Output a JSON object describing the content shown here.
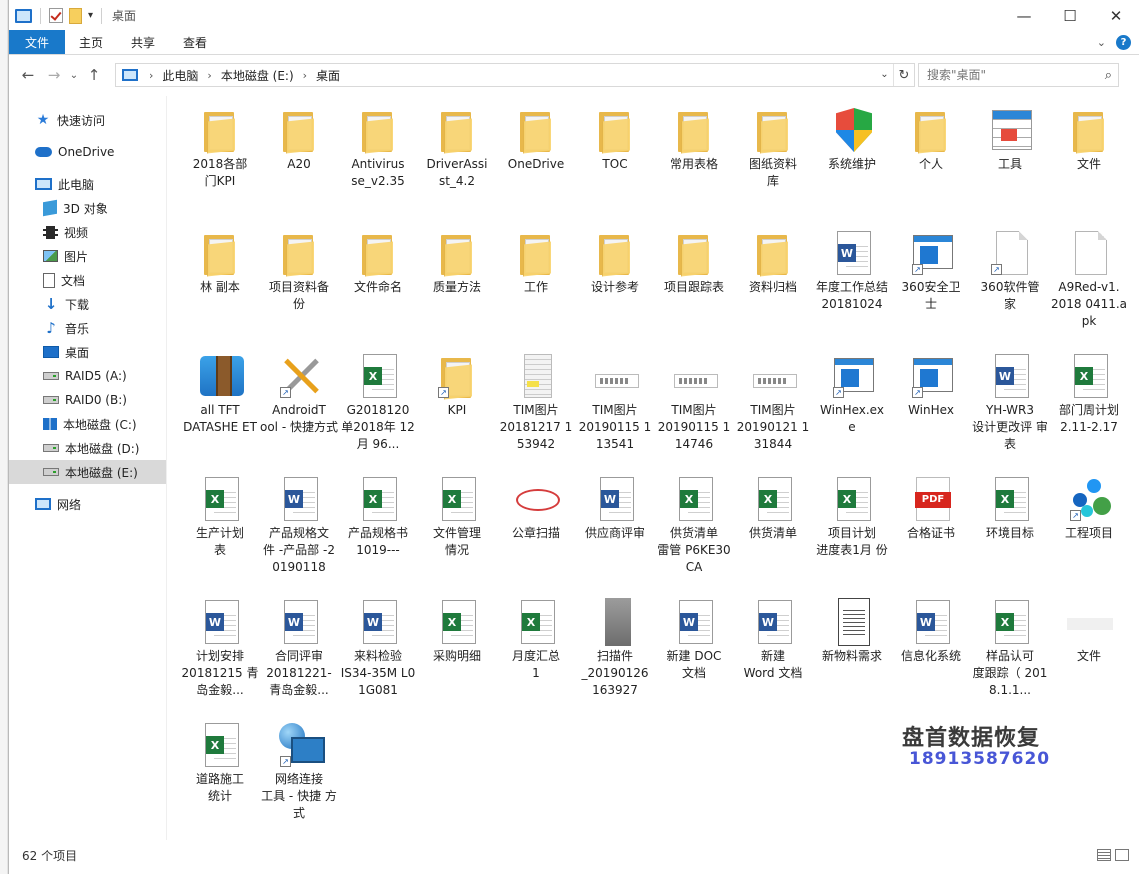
{
  "window": {
    "title": "桌面",
    "minimize_glyph": "—",
    "maximize_glyph": "☐",
    "close_glyph": "✕",
    "qa_dropdown_glyph": "▾"
  },
  "ribbon": {
    "tabs": [
      "文件",
      "主页",
      "共享",
      "查看"
    ],
    "expand_glyph": "⌄",
    "help_glyph": "?"
  },
  "nav_buttons": {
    "back": "←",
    "forward": "→",
    "recent": "⌄",
    "up": "↑"
  },
  "address": {
    "crumbs": [
      "此电脑",
      "本地磁盘 (E:)",
      "桌面"
    ],
    "sep": "›",
    "dropdown": "⌄",
    "refresh": "↻"
  },
  "search": {
    "placeholder": "搜索\"桌面\"",
    "icon": "⌕"
  },
  "navpane": {
    "items": [
      {
        "label": "快速访问",
        "icon": "star-icon"
      },
      {
        "label": "OneDrive",
        "icon": "cloud-icon"
      },
      {
        "label": "此电脑",
        "icon": "computer-icon"
      },
      {
        "label": "3D 对象",
        "icon": "cube-icon"
      },
      {
        "label": "视频",
        "icon": "video-icon"
      },
      {
        "label": "图片",
        "icon": "picture-icon"
      },
      {
        "label": "文档",
        "icon": "document-icon"
      },
      {
        "label": "下载",
        "icon": "download-icon"
      },
      {
        "label": "音乐",
        "icon": "music-icon"
      },
      {
        "label": "桌面",
        "icon": "desktop-icon"
      },
      {
        "label": "RAID5 (A:)",
        "icon": "drive-icon"
      },
      {
        "label": "RAID0 (B:)",
        "icon": "drive-icon"
      },
      {
        "label": "本地磁盘 (C:)",
        "icon": "windows-drive-icon"
      },
      {
        "label": "本地磁盘 (D:)",
        "icon": "drive-icon"
      },
      {
        "label": "本地磁盘 (E:)",
        "icon": "drive-icon"
      },
      {
        "label": "网络",
        "icon": "network-icon"
      }
    ]
  },
  "files": [
    {
      "a": "2018各部",
      "b": "门KPI",
      "icon": "folder"
    },
    {
      "a": "A20",
      "b": "",
      "icon": "folder"
    },
    {
      "a": "Antivirus",
      "b": "se_v2.35",
      "icon": "folder"
    },
    {
      "a": "DriverAssi",
      "b": "st_4.2",
      "icon": "folder"
    },
    {
      "a": "OneDrive",
      "b": "",
      "icon": "folder"
    },
    {
      "a": "TOC",
      "b": "",
      "icon": "folder"
    },
    {
      "a": "常用表格",
      "b": "",
      "icon": "folder"
    },
    {
      "a": "图纸资料",
      "b": "库",
      "icon": "folder"
    },
    {
      "a": "系统维护",
      "b": "",
      "icon": "shield"
    },
    {
      "a": "个人",
      "b": "",
      "icon": "folder"
    },
    {
      "a": "工具",
      "b": "",
      "icon": "calendar"
    },
    {
      "a": "文件",
      "b": "",
      "icon": "folder"
    },
    {
      "a": "林 副本",
      "b": "",
      "icon": "folder"
    },
    {
      "a": "项目资料备",
      "b": "份",
      "icon": "folder"
    },
    {
      "a": "文件命名",
      "b": "",
      "icon": "folder"
    },
    {
      "a": "质量方法",
      "b": "",
      "icon": "folder"
    },
    {
      "a": "工作",
      "b": "",
      "icon": "folder"
    },
    {
      "a": "设计参考",
      "b": "",
      "icon": "folder"
    },
    {
      "a": "项目跟踪表",
      "b": "",
      "icon": "folder"
    },
    {
      "a": "资料归档",
      "b": "",
      "icon": "folder"
    },
    {
      "a": "年度工作总结",
      "b": "20181024",
      "icon": "word"
    },
    {
      "a": "360安全卫",
      "b": "士",
      "icon": "winapp",
      "sc": true
    },
    {
      "a": "360软件管",
      "b": "家",
      "icon": "plain",
      "sc": true
    },
    {
      "a": "A9Red-v1.",
      "b": "2018 0411.apk",
      "icon": "plain"
    },
    {
      "a": "all TFT",
      "b": "DATASHE ET",
      "icon": "archive"
    },
    {
      "a": "AndroidT",
      "b": "ool - 快捷方式",
      "icon": "tools",
      "sc": true
    },
    {
      "a": "G2018120",
      "b": "单2018年 12月 96...",
      "icon": "excel"
    },
    {
      "a": "KPI",
      "b": "",
      "icon": "folder",
      "sc": true
    },
    {
      "a": "TIM图片",
      "b": "20181217 153942",
      "icon": "scan"
    },
    {
      "a": "TIM图片",
      "b": "20190115 113541",
      "icon": "strip"
    },
    {
      "a": "TIM图片",
      "b": "20190115 114746",
      "icon": "strip"
    },
    {
      "a": "TIM图片",
      "b": "20190121 131844",
      "icon": "strip"
    },
    {
      "a": "WinHex.ex",
      "b": "e",
      "icon": "winapp",
      "sc": true
    },
    {
      "a": "WinHex",
      "b": "",
      "icon": "winapp",
      "sc": true
    },
    {
      "a": "YH-WR3",
      "b": "设计更改评 审表",
      "icon": "word"
    },
    {
      "a": "部门周计划",
      "b": "2.11-2.17",
      "icon": "excel"
    },
    {
      "a": "生产计划",
      "b": "表",
      "icon": "excel"
    },
    {
      "a": "产品规格文",
      "b": "件 -产品部 -20190118",
      "icon": "word"
    },
    {
      "a": "产品规格书",
      "b": "1019---",
      "icon": "excel"
    },
    {
      "a": "文件管理",
      "b": "情况",
      "icon": "excel"
    },
    {
      "a": "公章扫描",
      "b": "",
      "icon": "stamp"
    },
    {
      "a": "供应商评审",
      "b": "",
      "icon": "word"
    },
    {
      "a": "供货清单",
      "b": "雷管 P6KE30CA",
      "icon": "excel"
    },
    {
      "a": "供货清单",
      "b": "",
      "icon": "excel"
    },
    {
      "a": "项目计划",
      "b": "进度表1月 份",
      "icon": "excel"
    },
    {
      "a": "合格证书",
      "b": "",
      "icon": "pdf"
    },
    {
      "a": "环境目标",
      "b": "",
      "icon": "excel"
    },
    {
      "a": "工程项目",
      "b": "",
      "icon": "molecule",
      "sc": true
    },
    {
      "a": "计划安排",
      "b": "20181215 青岛金毅...",
      "icon": "word"
    },
    {
      "a": "合同评审",
      "b": "20181221- 青岛金毅...",
      "icon": "word"
    },
    {
      "a": "来料检验",
      "b": "IS34-35M L01G081",
      "icon": "word"
    },
    {
      "a": "采购明细",
      "b": "",
      "icon": "excel"
    },
    {
      "a": "月度汇总",
      "b": "1",
      "icon": "excel"
    },
    {
      "a": "扫描件",
      "b": "_20190126 163927",
      "icon": "photo"
    },
    {
      "a": "新建 DOC",
      "b": "文档",
      "icon": "word"
    },
    {
      "a": "新建",
      "b": "Word 文档",
      "icon": "word"
    },
    {
      "a": "新物料需求",
      "b": "",
      "icon": "scandoc"
    },
    {
      "a": "信息化系统",
      "b": "",
      "icon": "word"
    },
    {
      "a": "样品认可",
      "b": "度跟踪（ 2018.1.1...",
      "icon": "excel"
    },
    {
      "a": "文件",
      "b": "",
      "icon": "faint"
    },
    {
      "a": "道路施工",
      "b": "统计",
      "icon": "excel"
    },
    {
      "a": "网络连接",
      "b": "工具 - 快捷 方式",
      "icon": "globe",
      "sc": true
    }
  ],
  "watermark": {
    "line1": "盘首数据恢复",
    "line2": "18913587620"
  },
  "status": {
    "count": "62 个项目"
  }
}
